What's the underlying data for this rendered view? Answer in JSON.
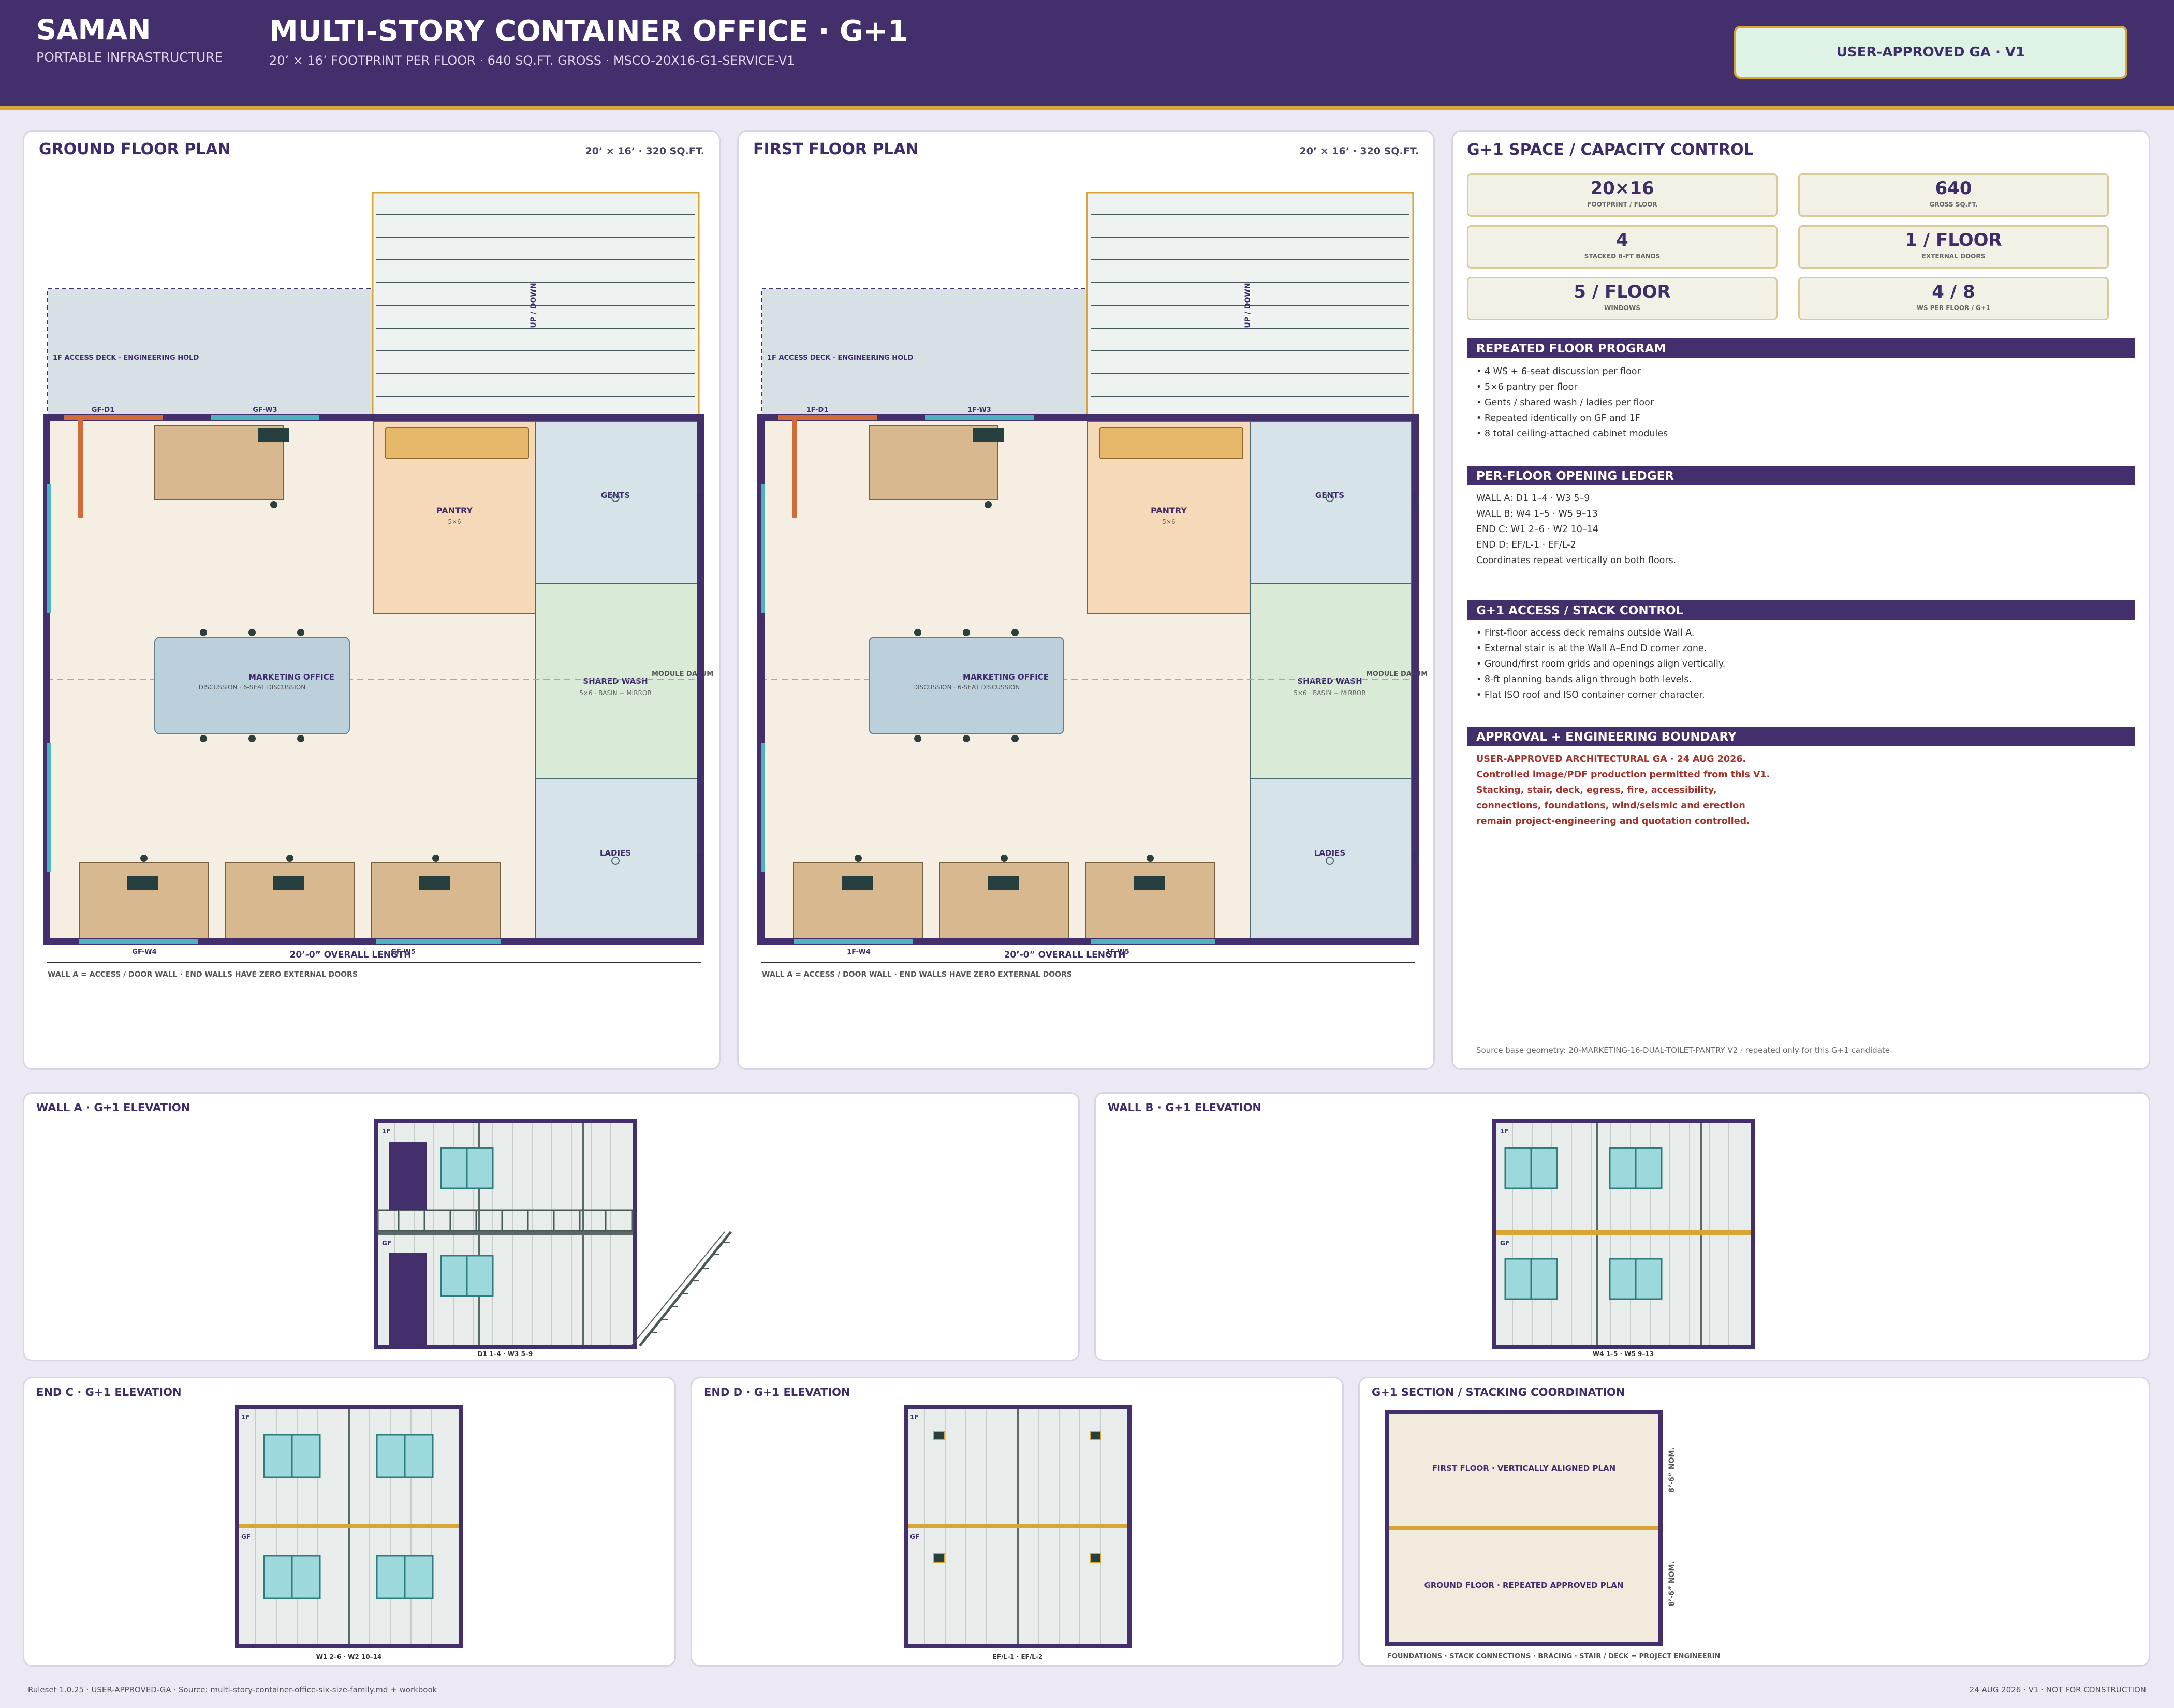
{
  "header": {
    "brand": "SAMAN",
    "brand_sub": "PORTABLE INFRASTRUCTURE",
    "title": "MULTI-STORY CONTAINER OFFICE · G+1",
    "subtitle": "20’ × 16’ FOOTPRINT PER FLOOR · 640 SQ.FT. GROSS · MSCO-20X16-G1-SERVICE-V1",
    "badge": "USER-APPROVED GA · V1"
  },
  "ground": {
    "title": "GROUND FLOOR PLAN",
    "meta": "20’ × 16’ · 320 SQ.FT.",
    "deck": "1F ACCESS DECK · ENGINEERING HOLD",
    "stair": "UP / DOWN",
    "d1": "GF-D1",
    "w3": "GF-W3",
    "w4": "GF-W4",
    "w5": "GF-W5",
    "pantry": "PANTRY",
    "pantry_sub": "5×6",
    "gents": "GENTS",
    "wash": "SHARED WASH",
    "wash_sub": "5×6 · BASIN + MIRROR",
    "datum": "MODULE DATUM",
    "ladies": "LADIES",
    "office": "MARKETING OFFICE",
    "office_sub": "DISCUSSION · 6-SEAT DISCUSSION",
    "overall": "20’-0” OVERALL LENGTH",
    "note": "WALL A = ACCESS / DOOR WALL · END WALLS HAVE ZERO EXTERNAL DOORS"
  },
  "first": {
    "title": "FIRST FLOOR PLAN",
    "meta": "20’ × 16’ · 320 SQ.FT.",
    "deck": "1F ACCESS DECK · ENGINEERING HOLD",
    "stair": "UP / DOWN",
    "d1": "1F-D1",
    "w3": "1F-W3",
    "w4": "1F-W4",
    "w5": "1F-W5",
    "pantry": "PANTRY",
    "pantry_sub": "5×6",
    "gents": "GENTS",
    "wash": "SHARED WASH",
    "wash_sub": "5×6 · BASIN + MIRROR",
    "datum": "MODULE DATUM",
    "ladies": "LADIES",
    "office": "MARKETING OFFICE",
    "office_sub": "DISCUSSION · 6-SEAT DISCUSSION",
    "overall": "20’-0” OVERALL LENGTH",
    "note": "WALL A = ACCESS / DOOR WALL · END WALLS HAVE ZERO EXTERNAL DOORS"
  },
  "control": {
    "title": "G+1 SPACE / CAPACITY CONTROL",
    "cards": [
      {
        "value": "20×16",
        "label": "FOOTPRINT / FLOOR"
      },
      {
        "value": "640",
        "label": "GROSS SQ.FT."
      },
      {
        "value": "4",
        "label": "STACKED 8-FT BANDS"
      },
      {
        "value": "1 / FLOOR",
        "label": "EXTERNAL DOORS"
      },
      {
        "value": "5 / FLOOR",
        "label": "WINDOWS"
      },
      {
        "value": "4 / 8",
        "label": "WS PER FLOOR / G+1"
      }
    ],
    "sections": [
      {
        "title": "REPEATED FLOOR PROGRAM",
        "lines": [
          "• 4 WS + 6-seat discussion per floor",
          "• 5×6 pantry per floor",
          "• Gents / shared wash / ladies per floor",
          "• Repeated identically on GF and 1F",
          "• 8 total ceiling-attached cabinet modules"
        ]
      },
      {
        "title": "PER-FLOOR OPENING LEDGER",
        "lines": [
          "WALL A: D1 1–4 · W3 5–9",
          "WALL B: W4 1–5 · W5 9–13",
          "END C: W1 2–6 · W2 10–14",
          "END D: EF/L-1 · EF/L-2",
          "Coordinates repeat vertically on both floors."
        ]
      },
      {
        "title": "G+1 ACCESS / STACK CONTROL",
        "lines": [
          "• First-floor access deck remains outside Wall A.",
          "• External stair is at the Wall A–End D corner zone.",
          "• Ground/first room grids and openings align vertically.",
          "• 8-ft planning bands align through both levels.",
          "• Flat ISO roof and ISO container corner character."
        ]
      },
      {
        "title": "APPROVAL + ENGINEERING BOUNDARY",
        "lines": [
          "USER-APPROVED ARCHITECTURAL GA · 24 AUG 2026.",
          "Controlled image/PDF production permitted from this V1.",
          "Stacking, stair, deck, egress, fire, accessibility,",
          "connections, foundations, wind/seismic and erection",
          "remain project-engineering and quotation controlled."
        ]
      }
    ],
    "source": "Source base geometry: 20-MARKETING-16-DUAL-TOILET-PANTRY V2 · repeated only for this G+1 candidate"
  },
  "elevations": {
    "wall_a": {
      "title": "WALL A · G+1 ELEVATION",
      "caption": "D1 1–4 · W3 5–9",
      "f1": "1F",
      "gf": "GF"
    },
    "wall_b": {
      "title": "WALL B · G+1 ELEVATION",
      "caption": "W4 1–5 · W5 9–13",
      "f1": "1F",
      "gf": "GF"
    },
    "end_c": {
      "title": "END C · G+1 ELEVATION",
      "caption": "W1 2–6 · W2 10–14",
      "f1": "1F",
      "gf": "GF"
    },
    "end_d": {
      "title": "END D · G+1 ELEVATION",
      "caption": "EF/L-1 · EF/L-2",
      "f1": "1F",
      "gf": "GF"
    }
  },
  "section": {
    "title": "G+1 SECTION / STACKING COORDINATION",
    "upper": "FIRST FLOOR · VERTICALLY ALIGNED PLAN",
    "lower": "GROUND FLOOR · REPEATED APPROVED PLAN",
    "dim_upper": "8’-6” NOM.",
    "dim_lower": "8’-6” NOM.",
    "note": "FOUNDATIONS · STACK CONNECTIONS · BRACING · STAIR / DECK = PROJECT ENGINEERING HOLD"
  },
  "footer": {
    "left": "Ruleset 1.0.25 · USER-APPROVED-GA · Source: multi-story-container-office-six-size-family.md + workbook",
    "right": "24 AUG 2026 · V1 · NOT FOR CONSTRUCTION"
  },
  "colors": {
    "brand_purple": "#432f6b",
    "accent_gold": "#d8a634",
    "window_teal": "#9dd8dc",
    "pantry": "#f5d9b8",
    "wash": "#d9ead7",
    "toilet": "#d6e4ea",
    "office": "#bcd0dc",
    "desk": "#d8b98f",
    "floor": "#f5efe3",
    "door_orange": "#cf6c3c"
  }
}
